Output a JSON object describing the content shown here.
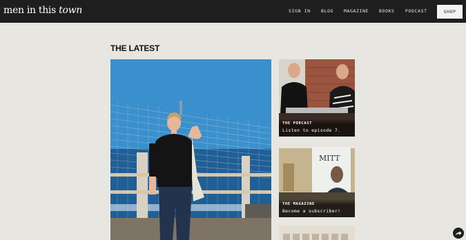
{
  "header": {
    "logo_main": "men in this",
    "logo_italic": "town",
    "nav": [
      "SIGN IN",
      "BLOG",
      "MAGAZINE",
      "BOOKS",
      "PODCAST"
    ],
    "shop_label": "SHOP"
  },
  "main": {
    "heading": "THE LATEST"
  },
  "cards": [
    {
      "kicker": "THE PODCAST",
      "text": "Listen to episode 7."
    },
    {
      "kicker": "THE MAGAZINE",
      "text": "Become a subscriber!",
      "cover_title": "MITT"
    }
  ],
  "icons": {
    "share": "share-arrow-icon"
  },
  "colors": {
    "topbar": "#1e1e1e",
    "page_bg": "#e7e6e1",
    "sky": "#2f86c6",
    "sea": "#1f5f96"
  }
}
